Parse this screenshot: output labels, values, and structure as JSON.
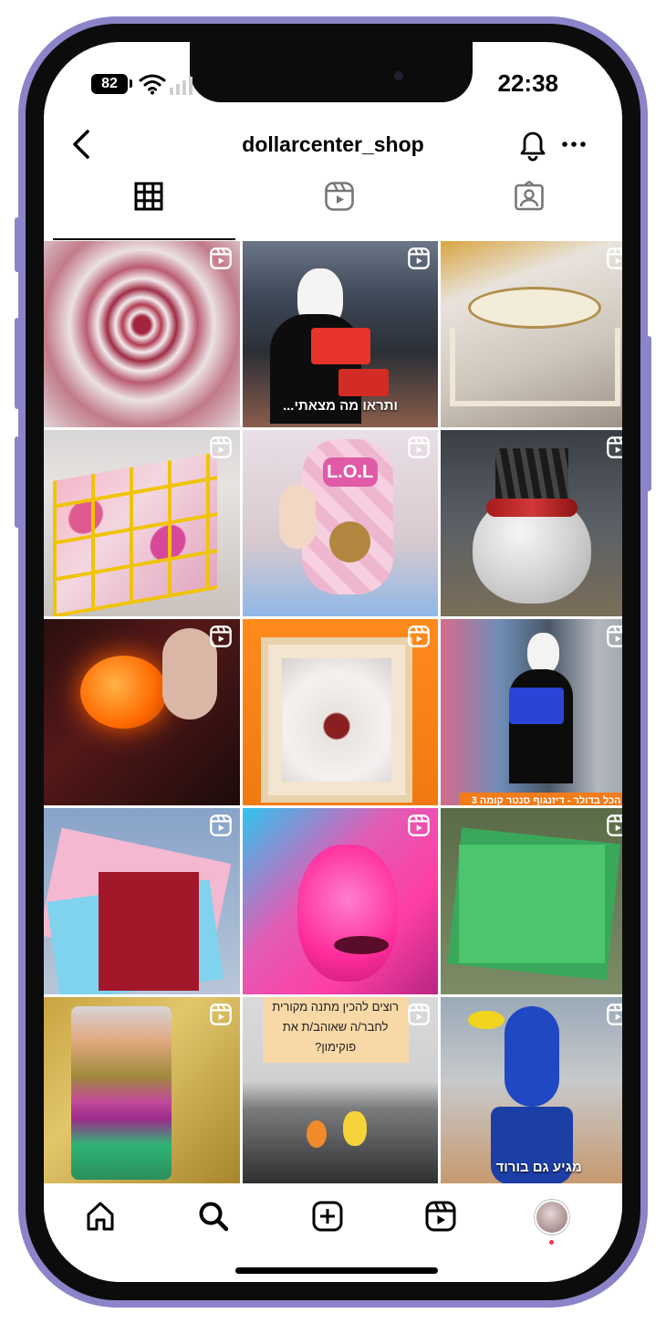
{
  "status": {
    "battery": "82",
    "time": "22:38"
  },
  "header": {
    "username": "dollarcenter_shop"
  },
  "tabs": [
    {
      "icon": "grid-icon",
      "active": true
    },
    {
      "icon": "reels-icon"
    },
    {
      "icon": "tagged-icon"
    }
  ],
  "posts": [
    {
      "subject": "tie-dye fabric"
    },
    {
      "subject": "scream costume in store",
      "caption": "ותראו מה מצאתי..."
    },
    {
      "subject": "wooden display stand"
    },
    {
      "subject": "bead organizer box"
    },
    {
      "subject": "LOL surprise doll"
    },
    {
      "subject": "bloody skull planter"
    },
    {
      "subject": "glowing pumpkin lamp"
    },
    {
      "subject": "severed finger box"
    },
    {
      "subject": "scream mask with basket",
      "caption": "הכל בדולר - דיזנגוף סנטר קומה 3"
    },
    {
      "subject": "touch notebooks"
    },
    {
      "subject": "pink huggy plush"
    },
    {
      "subject": "green campus notebooks"
    },
    {
      "subject": "sequin craft set"
    },
    {
      "subject": "pokemon figures",
      "caption": "רוצים להכין מתנה מקורית לחבר/ה שאוהב/ת את פוקימון?"
    },
    {
      "subject": "blue huggy wuggy",
      "caption": "מגיע גם בורוד"
    }
  ],
  "tabbar": [
    "home-icon",
    "search-icon",
    "create-icon",
    "reels-icon",
    "profile-avatar"
  ]
}
